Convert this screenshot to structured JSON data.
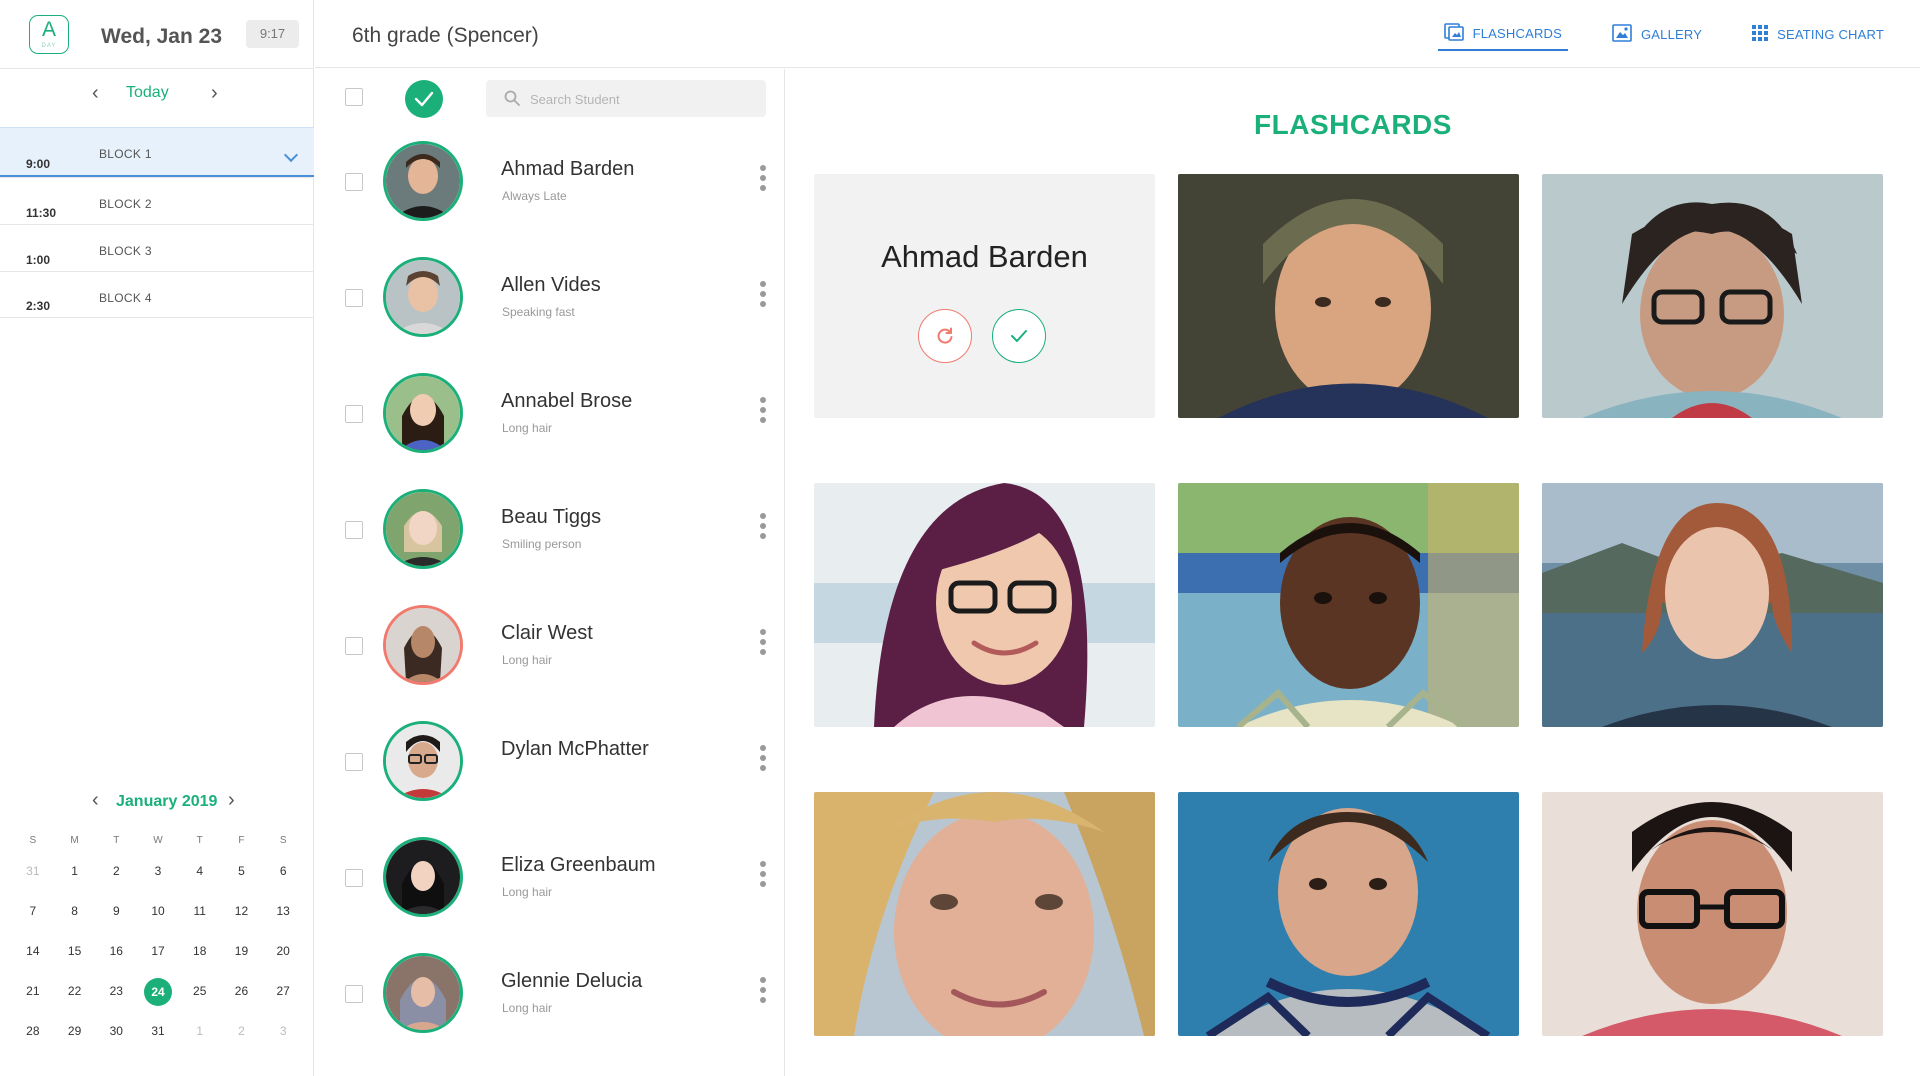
{
  "sidebar": {
    "badge_letter": "A",
    "badge_sub": "DAY",
    "date": "Wed, Jan 23",
    "clock": "9:17",
    "today_label": "Today",
    "blocks": [
      {
        "time": "9:00",
        "name": "BLOCK 1"
      },
      {
        "time": "11:30",
        "name": "BLOCK 2"
      },
      {
        "time": "1:00",
        "name": "BLOCK 3"
      },
      {
        "time": "2:30",
        "name": "BLOCK 4"
      }
    ],
    "calendar": {
      "month": "January 2019",
      "dow": [
        "S",
        "M",
        "T",
        "W",
        "T",
        "F",
        "S"
      ],
      "weeks": [
        [
          "31",
          "1",
          "2",
          "3",
          "4",
          "5",
          "6"
        ],
        [
          "7",
          "8",
          "9",
          "10",
          "11",
          "12",
          "13"
        ],
        [
          "14",
          "15",
          "16",
          "17",
          "18",
          "19",
          "20"
        ],
        [
          "21",
          "22",
          "23",
          "24",
          "25",
          "26",
          "27"
        ],
        [
          "28",
          "29",
          "30",
          "31",
          "1",
          "2",
          "3"
        ]
      ],
      "selected": "24"
    }
  },
  "header": {
    "class_title": "6th grade (Spencer)",
    "tabs": [
      {
        "label": "FLASHCARDS",
        "icon": "flashcards-icon"
      },
      {
        "label": "GALLERY",
        "icon": "gallery-icon"
      },
      {
        "label": "SEATING CHART",
        "icon": "grid-icon"
      }
    ]
  },
  "list": {
    "search_placeholder": "Search Student",
    "students": [
      {
        "name": "Ahmad Barden",
        "note": "Always Late"
      },
      {
        "name": "Allen Vides",
        "note": "Speaking fast"
      },
      {
        "name": "Annabel Brose",
        "note": "Long hair"
      },
      {
        "name": "Beau Tiggs",
        "note": "Smiling person"
      },
      {
        "name": "Clair West",
        "note": "Long hair"
      },
      {
        "name": "Dylan McPhatter",
        "note": ""
      },
      {
        "name": "Eliza Greenbaum",
        "note": "Long hair"
      },
      {
        "name": "Glennie Delucia",
        "note": "Long hair"
      }
    ]
  },
  "flashcards": {
    "title": "FLASHCARDS",
    "current_name": "Ahmad Barden"
  },
  "colors": {
    "accent_green": "#1bb07a",
    "accent_blue": "#2f7fd6",
    "alert_red": "#f07a6e"
  }
}
